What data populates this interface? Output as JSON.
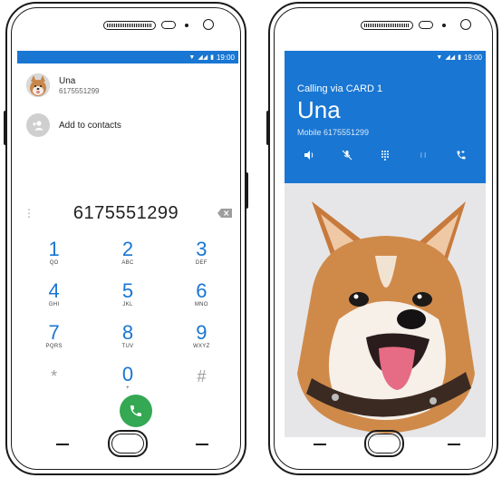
{
  "left_phone": {
    "status_time": "19:00",
    "contact": {
      "name": "Una",
      "number": "6175551299"
    },
    "add_to_contacts": "Add to contacts",
    "dialed_number": "6175551299",
    "keys": [
      {
        "digit": "1",
        "letters": "QO"
      },
      {
        "digit": "2",
        "letters": "ABC"
      },
      {
        "digit": "3",
        "letters": "DEF"
      },
      {
        "digit": "4",
        "letters": "GHI"
      },
      {
        "digit": "5",
        "letters": "JKL"
      },
      {
        "digit": "6",
        "letters": "MNO"
      },
      {
        "digit": "7",
        "letters": "PQRS"
      },
      {
        "digit": "8",
        "letters": "TUV"
      },
      {
        "digit": "9",
        "letters": "WXYZ"
      },
      {
        "digit": "*",
        "letters": ""
      },
      {
        "digit": "0",
        "letters": "+"
      },
      {
        "digit": "#",
        "letters": ""
      }
    ],
    "call_button_icon": "phone-icon"
  },
  "right_phone": {
    "status_time": "19:00",
    "calling_via": "Calling via CARD 1",
    "caller_name": "Una",
    "caller_number": "Mobile 6175551299",
    "actions": [
      "speaker-icon",
      "mute-icon",
      "dialpad-icon",
      "pause-icon",
      "add-call-icon"
    ]
  },
  "colors": {
    "primary": "#1976d2",
    "call_green": "#34a853",
    "frame": "#1a1a1a"
  }
}
